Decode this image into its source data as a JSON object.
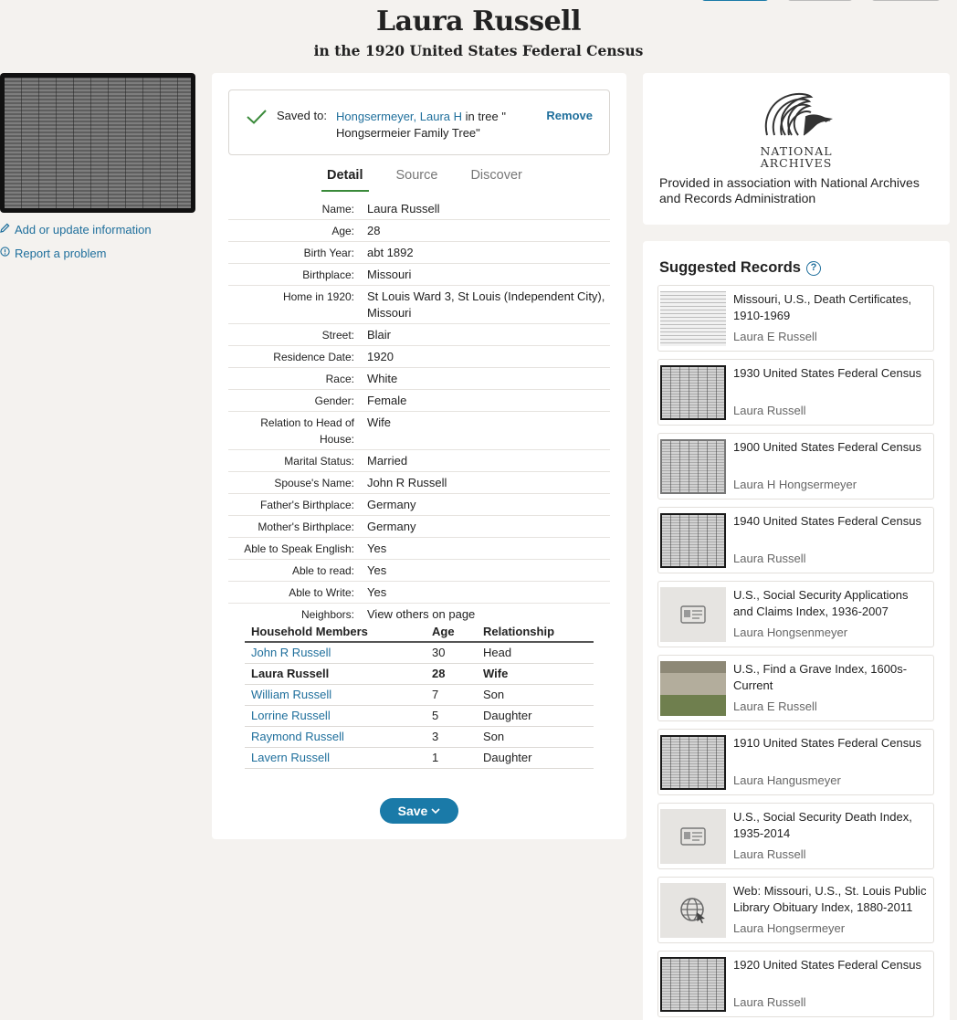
{
  "header": {
    "title": "Laura Russell",
    "subtitle": "in the 1920 United States Federal Census"
  },
  "left": {
    "add_link": "Add or update information",
    "report_link": "Report a problem"
  },
  "saved": {
    "label": "Saved to:",
    "person_link": "Hongsermeyer, Laura H",
    "in_tree": " in tree \"",
    "tree_name": "Hongsermeier Family Tree\"",
    "remove": "Remove"
  },
  "tabs": [
    "Detail",
    "Source",
    "Discover"
  ],
  "details": [
    {
      "k": "Name:",
      "v": "Laura Russell"
    },
    {
      "k": "Age:",
      "v": "28"
    },
    {
      "k": "Birth Year:",
      "v": "abt 1892"
    },
    {
      "k": "Birthplace:",
      "v": "Missouri"
    },
    {
      "k": "Home in 1920:",
      "v": "St Louis Ward 3, St Louis (Independent City), Missouri"
    },
    {
      "k": "Street:",
      "v": "Blair"
    },
    {
      "k": "Residence Date:",
      "v": "1920"
    },
    {
      "k": "Race:",
      "v": "White"
    },
    {
      "k": "Gender:",
      "v": "Female"
    },
    {
      "k": "Relation to Head of House:",
      "v": "Wife"
    },
    {
      "k": "Marital Status:",
      "v": "Married"
    },
    {
      "k": "Spouse's Name:",
      "v": "John R Russell"
    },
    {
      "k": "Father's Birthplace:",
      "v": "Germany"
    },
    {
      "k": "Mother's Birthplace:",
      "v": "Germany"
    },
    {
      "k": "Able to Speak English:",
      "v": "Yes"
    },
    {
      "k": "Able to read:",
      "v": "Yes"
    },
    {
      "k": "Able to Write:",
      "v": "Yes"
    },
    {
      "k": "Neighbors:",
      "v": "View others on page"
    }
  ],
  "household": {
    "headers": [
      "Household Members",
      "Age",
      "Relationship"
    ],
    "rows": [
      {
        "name": "John R Russell",
        "age": "30",
        "rel": "Head"
      },
      {
        "name": "Laura Russell",
        "age": "28",
        "rel": "Wife"
      },
      {
        "name": "William Russell",
        "age": "7",
        "rel": "Son"
      },
      {
        "name": "Lorrine Russell",
        "age": "5",
        "rel": "Daughter"
      },
      {
        "name": "Raymond Russell",
        "age": "3",
        "rel": "Son"
      },
      {
        "name": "Lavern Russell",
        "age": "1",
        "rel": "Daughter"
      }
    ]
  },
  "save_button": "Save",
  "archives": {
    "logo_line1": "NATIONAL",
    "logo_line2": "ARCHIVES",
    "provided": "Provided in association with National Archives and Records Administration"
  },
  "suggested": {
    "title": "Suggested Records",
    "records": [
      {
        "title": "Missouri, U.S., Death Certificates, 1910-1969",
        "name": "Laura E Russell",
        "thumb": "doc"
      },
      {
        "title": "1930 United States Federal Census",
        "name": "Laura Russell",
        "thumb": "census"
      },
      {
        "title": "1900 United States Federal Census",
        "name": "Laura H Hongsermeyer",
        "thumb": "census"
      },
      {
        "title": "1940 United States Federal Census",
        "name": "Laura Russell",
        "thumb": "census"
      },
      {
        "title": "U.S., Social Security Applications and Claims Index, 1936-2007",
        "name": "Laura Hongsenmeyer",
        "thumb": "id-card-icon"
      },
      {
        "title": "U.S., Find a Grave Index, 1600s-Current",
        "name": "Laura E Russell",
        "thumb": "grave"
      },
      {
        "title": "1910 United States Federal Census",
        "name": "Laura Hangusmeyer",
        "thumb": "census"
      },
      {
        "title": "U.S., Social Security Death Index, 1935-2014",
        "name": "Laura Russell",
        "thumb": "id-card-icon"
      },
      {
        "title": "Web: Missouri, U.S., St. Louis Public Library Obituary Index, 1880-2011",
        "name": "Laura Hongsermeyer",
        "thumb": "globe-icon"
      },
      {
        "title": "1920 United States Federal Census",
        "name": "Laura Russell",
        "thumb": "census"
      }
    ]
  },
  "colors": {
    "link": "#1f6f9c",
    "save_button": "#1a7aa8",
    "check": "#3a8a3a"
  }
}
